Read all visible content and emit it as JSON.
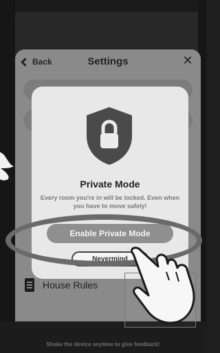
{
  "settings": {
    "back_label": "Back",
    "title": "Settings",
    "close_glyph": "✕",
    "house_rules_label": "House Rules"
  },
  "modal": {
    "title": "Private Mode",
    "description": "Every room you're in will be locked. Even when you have to move safely!",
    "primary_button": "Enable Private Mode",
    "secondary_button": "Nevermind"
  },
  "footer": {
    "feedback_text": "Shake the device anytime to give feedback!"
  },
  "icons": {
    "shield": "shield-lock-icon",
    "back": "chevron-left-icon",
    "close": "close-icon",
    "rules": "document-icon",
    "pointer": "hand-pointer-icon"
  },
  "colors": {
    "shield": "#4a4a4a",
    "primary_button": "#8f8f8f",
    "highlight_ring": "#6a6a6a"
  }
}
